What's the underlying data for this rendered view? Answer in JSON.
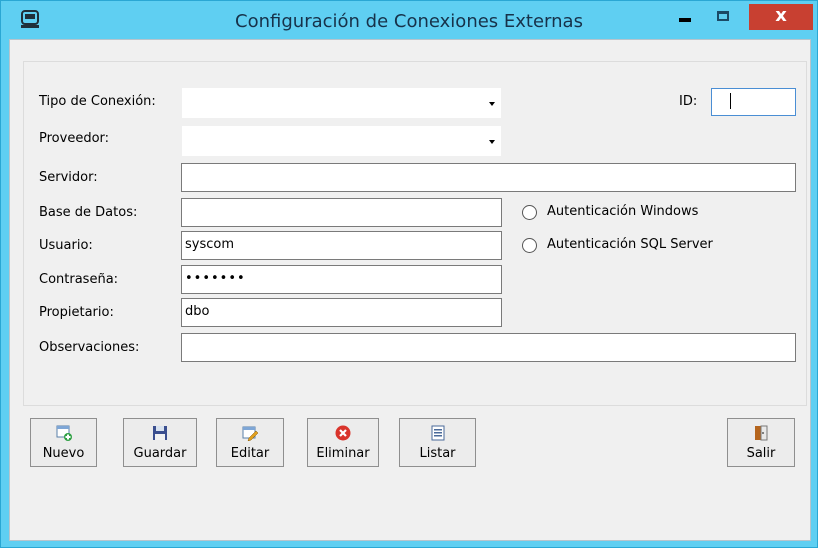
{
  "window": {
    "title": "Configuración de Conexiones Externas",
    "close_label": "x",
    "accent": "#5fcff2",
    "close_color": "#c84031"
  },
  "form": {
    "tipo_conexion_label": "Tipo de Conexión:",
    "tipo_conexion_value": "",
    "proveedor_label": "Proveedor:",
    "proveedor_value": "",
    "id_label": "ID:",
    "id_value": "",
    "servidor_label": "Servidor:",
    "servidor_value": "",
    "base_datos_label": "Base de Datos:",
    "base_datos_value": "",
    "usuario_label": "Usuario:",
    "usuario_value": "syscom",
    "contrasena_label": "Contraseña:",
    "contrasena_value": "•••••••",
    "propietario_label": "Propietario:",
    "propietario_value": "dbo",
    "observaciones_label": "Observaciones:",
    "observaciones_value": "",
    "auth_windows_label": "Autenticación Windows",
    "auth_sql_label": "Autenticación SQL Server"
  },
  "toolbar": {
    "nuevo": "Nuevo",
    "guardar": "Guardar",
    "editar": "Editar",
    "eliminar": "Eliminar",
    "listar": "Listar",
    "salir": "Salir"
  }
}
